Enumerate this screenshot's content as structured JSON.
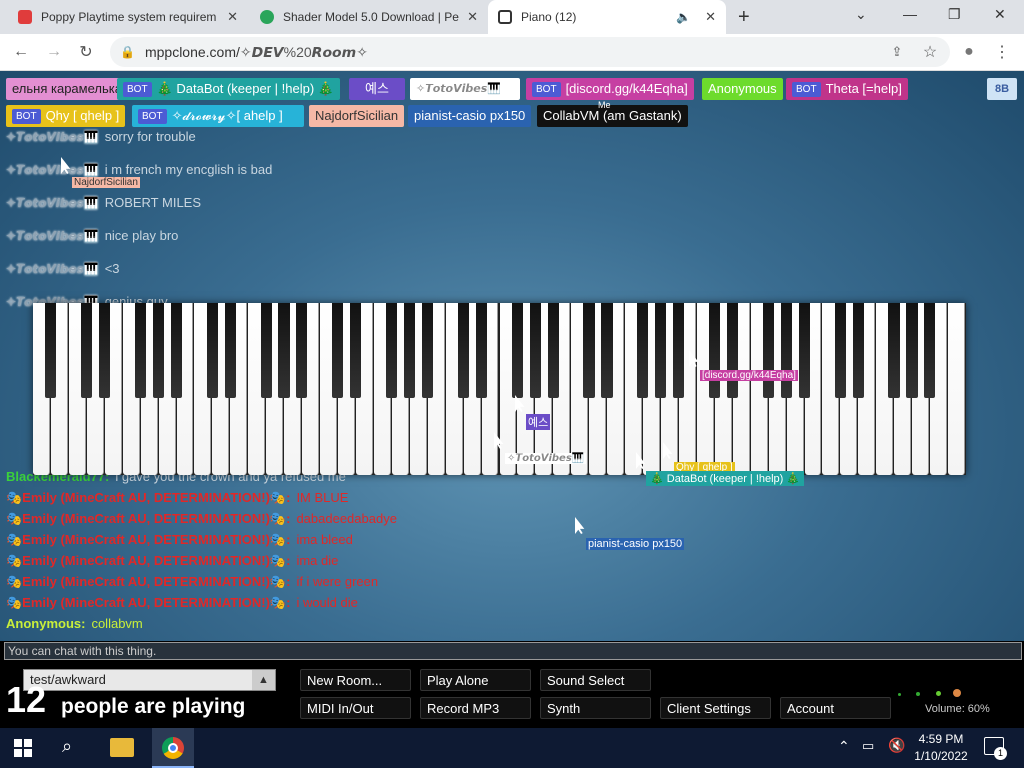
{
  "browser": {
    "tabs": [
      {
        "title": "Poppy Playtime system requirem",
        "favicon_color": "#e03c3c"
      },
      {
        "title": "Shader Model 5.0 Download | Pe",
        "favicon_color": "#2aa55a"
      },
      {
        "title": "Piano (12)",
        "favicon_color": "#333333",
        "active": true
      }
    ],
    "new_tab": "+",
    "url_host": "mppclone.com/",
    "url_path": "✧𝘿𝙀𝙑%20𝙍𝙤𝙤𝙢✧",
    "window_controls": {
      "minimize": "—",
      "restore": "❐",
      "close": "✕",
      "dropdown": "⌄"
    }
  },
  "users": [
    {
      "name": "ельня карамелька",
      "color": "#e38fd2",
      "text_color": "#222"
    },
    {
      "name": "🎄 DataBot (keeper | !help) 🎄",
      "bot": true,
      "color": "#20a3a0"
    },
    {
      "name": "예스",
      "color": "#6b4dc7"
    },
    {
      "name": "✧𝙏𝙤𝙩𝙤𝙑𝙞𝙗𝙚𝙨🎹",
      "color": "#ffffff",
      "text_color": "#888"
    },
    {
      "name": "[discord.gg/k44Eqha]",
      "bot": true,
      "color": "#c63fa2"
    },
    {
      "name": "Anonymous",
      "color": "#6ddb2c"
    },
    {
      "name": "Theta [=help]",
      "bot": true,
      "color": "#c0348a"
    },
    {
      "name": "Qhy [ qhelp ]",
      "bot": true,
      "color": "#e7c21a"
    },
    {
      "name": "✧𝓭𝓻𝓸𝔀𝓻𝔂✧[ ahelp ]",
      "bot": true,
      "color": "#27b3d8"
    },
    {
      "name": "NajdorfSicilian",
      "color": "#f5b8a6",
      "text_color": "#333"
    },
    {
      "name": "pianist-casio px150",
      "color": "#2a63b0"
    },
    {
      "name": "CollabVM (am Gastank)",
      "color": "#111111"
    }
  ],
  "me_label": "Me",
  "top_right_button": "8B",
  "chat": [
    {
      "name": "✧𝙏𝙤𝙩𝙤𝙑𝙞𝙗𝙚𝙨🎹",
      "msg": "sorry for trouble"
    },
    {
      "name": "✧𝙏𝙤𝙩𝙤𝙑𝙞𝙗𝙚𝙨🎹",
      "msg": "i m french my encglish is bad"
    },
    {
      "name": "✧𝙏𝙤𝙩𝙤𝙑𝙞𝙗𝙚𝙨🎹",
      "msg": "ROBERT MILES"
    },
    {
      "name": "✧𝙏𝙤𝙩𝙤𝙑𝙞𝙗𝙚𝙨🎹",
      "msg": "nice play bro"
    },
    {
      "name": "✧𝙏𝙤𝙩𝙤𝙑𝙞𝙗𝙚𝙨🎹",
      "msg": "<3"
    },
    {
      "name": "✧𝙏𝙤𝙩𝙤𝙑𝙞𝙗𝙚𝙨🎹",
      "msg": "genius guy"
    }
  ],
  "chat_lower": [
    {
      "name": "Blackemerald77:",
      "msg": "i gave you the crown and ya refused me"
    },
    {
      "name": "🎭Emily (MineCraft AU, DETERMINATION!)🎭:",
      "msg": "IM BLUE"
    },
    {
      "name": "🎭Emily (MineCraft AU, DETERMINATION!)🎭:",
      "msg": "dabadeedabadye"
    },
    {
      "name": "🎭Emily (MineCraft AU, DETERMINATION!)🎭:",
      "msg": "ima bleed"
    },
    {
      "name": "🎭Emily (MineCraft AU, DETERMINATION!)🎭:",
      "msg": "ima die"
    },
    {
      "name": "🎭Emily (MineCraft AU, DETERMINATION!)🎭:",
      "msg": "if i were green"
    },
    {
      "name": "🎭Emily (MineCraft AU, DETERMINATION!)🎭:",
      "msg": "i would die"
    },
    {
      "name": "Anonymous:",
      "msg": "collabvm"
    }
  ],
  "cursor_labels": {
    "najdorf": "NajdorfSicilian",
    "discord": "[discord.gg/k44Eqha]",
    "yes": "예스",
    "toto": "✧𝙏𝙤𝙩𝙤𝙑𝙞𝙗𝙚𝙨🎹",
    "qhy": "Qhy [ qhelp ]",
    "databot": "🎄 DataBot (keeper | !help) 🎄",
    "casio": "pianist-casio px150",
    "drowry": "✧𝓭𝓻𝓸𝔀"
  },
  "hint": "You can chat with this thing.",
  "room_input": "test/awkward",
  "player_count": "12",
  "player_count_suffix": "people are playing",
  "controls": {
    "new_room": "New Room...",
    "play_alone": "Play Alone",
    "sound_select": "Sound Select",
    "midi": "MIDI In/Out",
    "record": "Record MP3",
    "synth": "Synth",
    "client_settings": "Client Settings",
    "account": "Account"
  },
  "volume": "Volume: 60%",
  "taskbar": {
    "time": "4:59 PM",
    "date": "1/10/2022",
    "notifications": "1"
  }
}
